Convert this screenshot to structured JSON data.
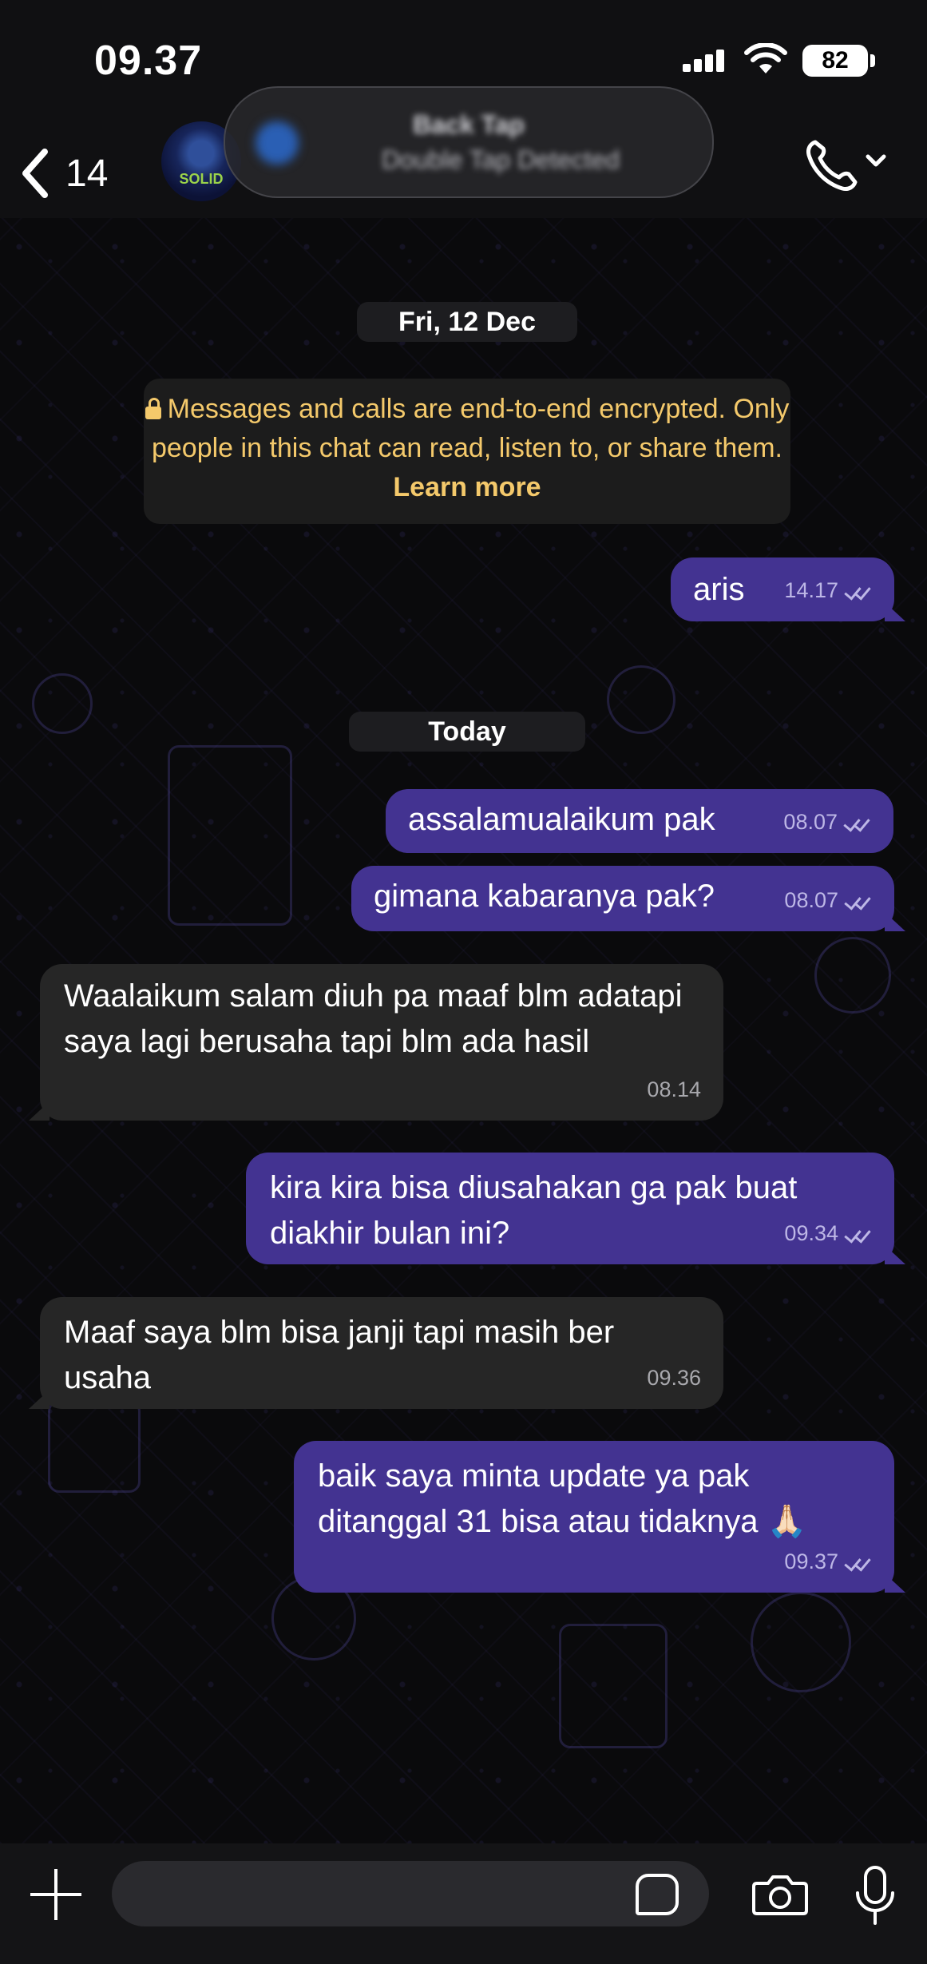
{
  "status_bar": {
    "time": "09.37",
    "battery": "82"
  },
  "header": {
    "back_count": "14",
    "contact_blurred_line1": "Back Tap",
    "contact_blurred_line2": "Double Tap Detected",
    "avatar_logo_text": "SOLID"
  },
  "chat": {
    "date_chip_1": "Fri, 12 Dec",
    "encryption_notice": "Messages and calls are end-to-end encrypted. Only people in this chat can read, listen to, or share them.",
    "encryption_link": "Learn more",
    "date_chip_2": "Today",
    "messages": [
      {
        "direction": "out",
        "text": "aris",
        "time": "14.17"
      },
      {
        "direction": "out",
        "text": "assalamualaikum pak",
        "time": "08.07"
      },
      {
        "direction": "out",
        "text": "gimana kabaranya pak?",
        "time": "08.07"
      },
      {
        "direction": "in",
        "text": "Waalaikum salam diuh pa maaf blm adatapi saya lagi berusaha tapi blm ada hasil",
        "time": "08.14"
      },
      {
        "direction": "out",
        "text": "kira kira bisa diusahakan ga pak buat diakhir bulan ini?",
        "time": "09.34"
      },
      {
        "direction": "in",
        "text": "Maaf saya blm bisa janji  tapi masih ber usaha",
        "time": "09.36"
      },
      {
        "direction": "out",
        "text": "baik saya minta update ya pak ditanggal 31 bisa atau tidaknya 🙏🏻",
        "time": "09.37"
      }
    ]
  },
  "colors": {
    "outgoing_bubble": "#433391",
    "incoming_bubble": "#262626",
    "notice_text": "#f4c96b"
  }
}
